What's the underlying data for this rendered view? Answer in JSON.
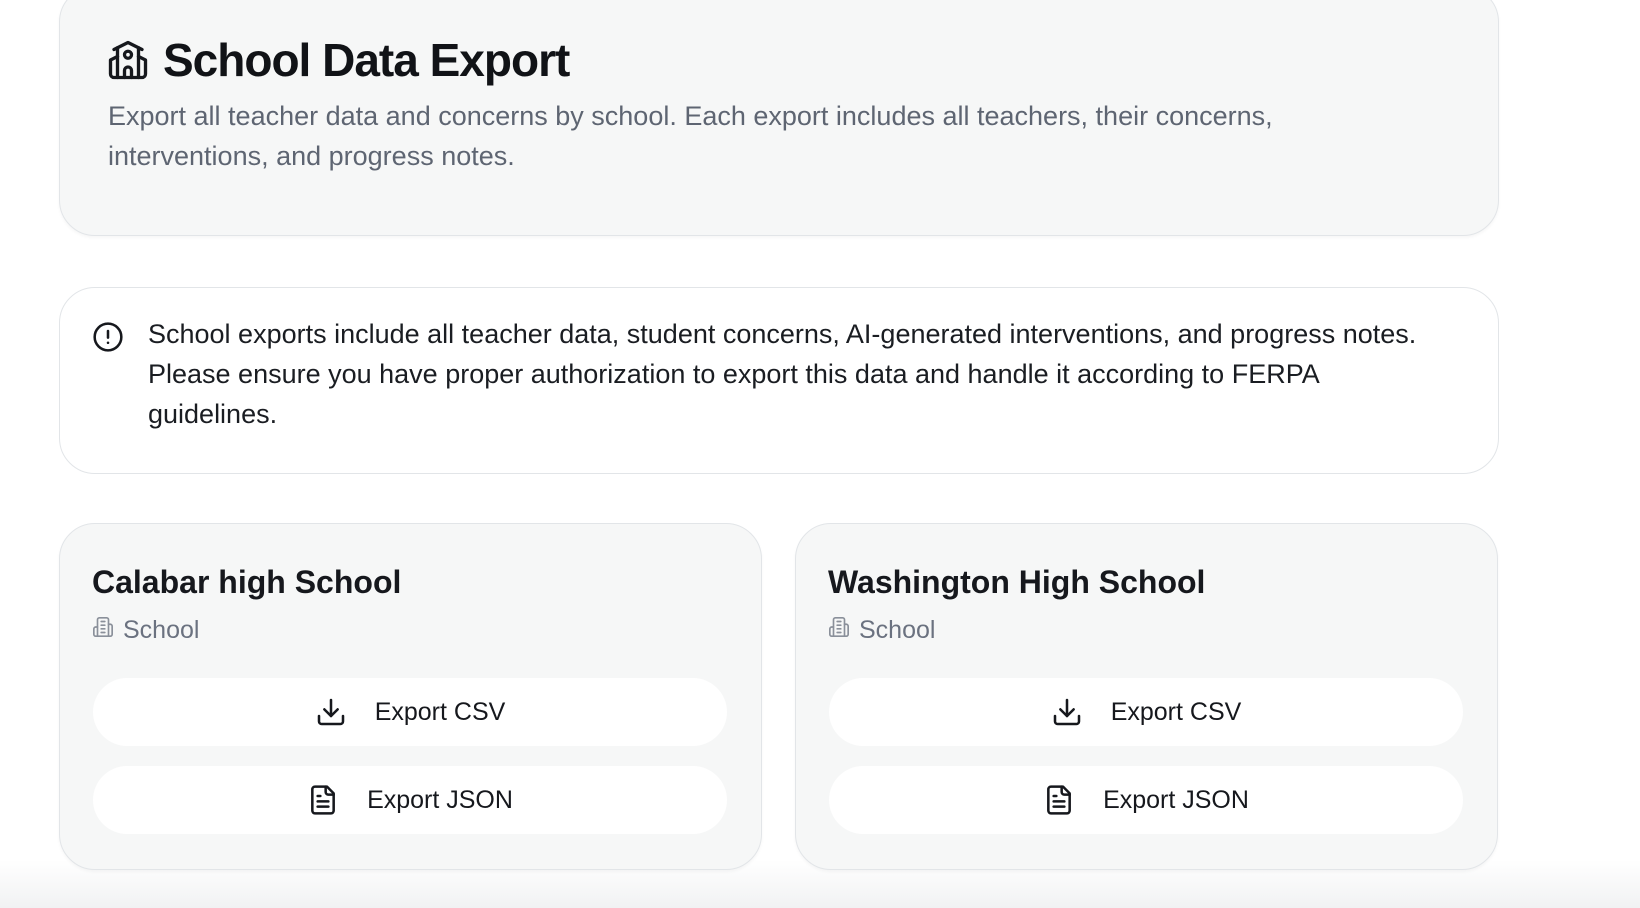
{
  "header": {
    "icon": "school-icon",
    "title": "School Data Export",
    "description": "Export all teacher data and concerns by school. Each export includes all teachers, their concerns, interventions, and progress notes."
  },
  "alert": {
    "icon": "alert-circle-icon",
    "text": "School exports include all teacher data, student concerns, AI-generated interventions, and progress notes. Please ensure you have proper authorization to export this data and handle it according to FERPA guidelines."
  },
  "schools": [
    {
      "name": "Calabar high School",
      "type_label": "School",
      "type_icon": "building-icon",
      "csv_label": "Export CSV",
      "csv_icon": "download-icon",
      "json_label": "Export JSON",
      "json_icon": "file-text-icon"
    },
    {
      "name": "Washington High School",
      "type_label": "School",
      "type_icon": "building-icon",
      "csv_label": "Export CSV",
      "csv_icon": "download-icon",
      "json_label": "Export JSON",
      "json_icon": "file-text-icon"
    }
  ],
  "colors": {
    "card_background": "#f6f7f7",
    "border": "#e2e5e8",
    "text_primary": "#16181d",
    "text_muted": "#5e6572"
  }
}
